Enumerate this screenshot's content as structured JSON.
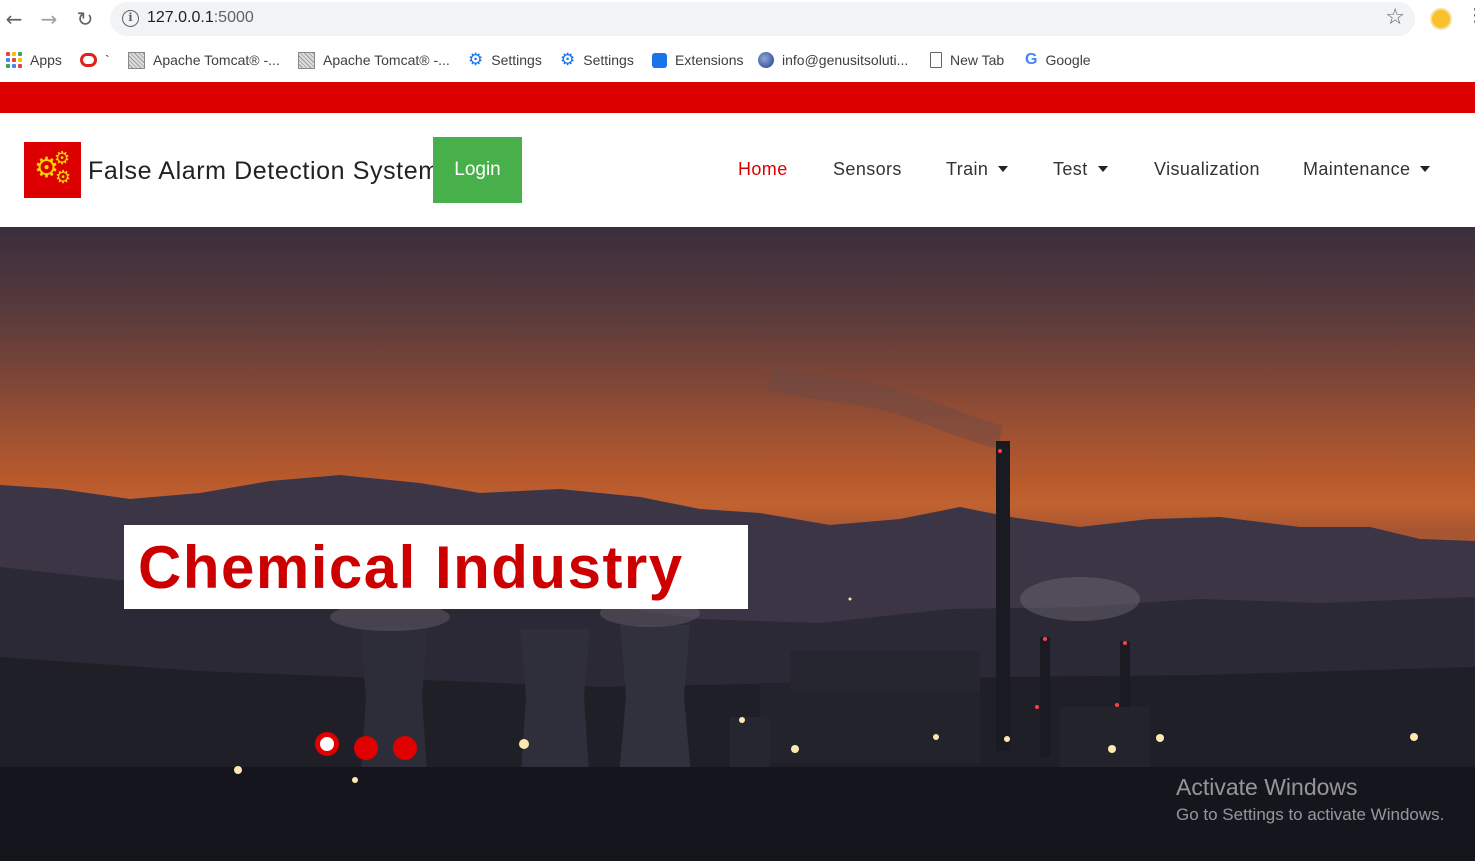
{
  "browser": {
    "url_host": "127.0.0.1",
    "url_port": ":5000",
    "bookmarks": [
      {
        "label": "Apps",
        "icon": "apps-grid-icon"
      },
      {
        "label": "`",
        "icon": "oracle-icon"
      },
      {
        "label": "Apache Tomcat® -...",
        "icon": "tomcat-icon"
      },
      {
        "label": "Apache Tomcat® -...",
        "icon": "tomcat-icon"
      },
      {
        "label": "Settings",
        "icon": "gear-icon"
      },
      {
        "label": "Settings",
        "icon": "gear-icon"
      },
      {
        "label": "Extensions",
        "icon": "puzzle-icon"
      },
      {
        "label": "info@genusitsoluti...",
        "icon": "globe-icon"
      },
      {
        "label": "New Tab",
        "icon": "page-icon"
      },
      {
        "label": "Google",
        "icon": "google-icon"
      }
    ]
  },
  "header": {
    "brand_title": "False Alarm Detection System",
    "login_label": "Login",
    "nav": [
      {
        "label": "Home",
        "active": true,
        "dropdown": false
      },
      {
        "label": "Sensors",
        "active": false,
        "dropdown": false
      },
      {
        "label": "Train",
        "active": false,
        "dropdown": true
      },
      {
        "label": "Test",
        "active": false,
        "dropdown": true
      },
      {
        "label": "Visualization",
        "active": false,
        "dropdown": false
      },
      {
        "label": "Maintenance",
        "active": false,
        "dropdown": true
      }
    ]
  },
  "hero": {
    "caption": "Chemical Industry",
    "active_slide": 1,
    "slide_count": 3
  },
  "watermark": {
    "title": "Activate Windows",
    "subtitle": "Go to Settings to activate Windows."
  },
  "colors": {
    "brand_red": "#dc0000",
    "login_green": "#47b04b",
    "nav_active": "#dc0000"
  }
}
